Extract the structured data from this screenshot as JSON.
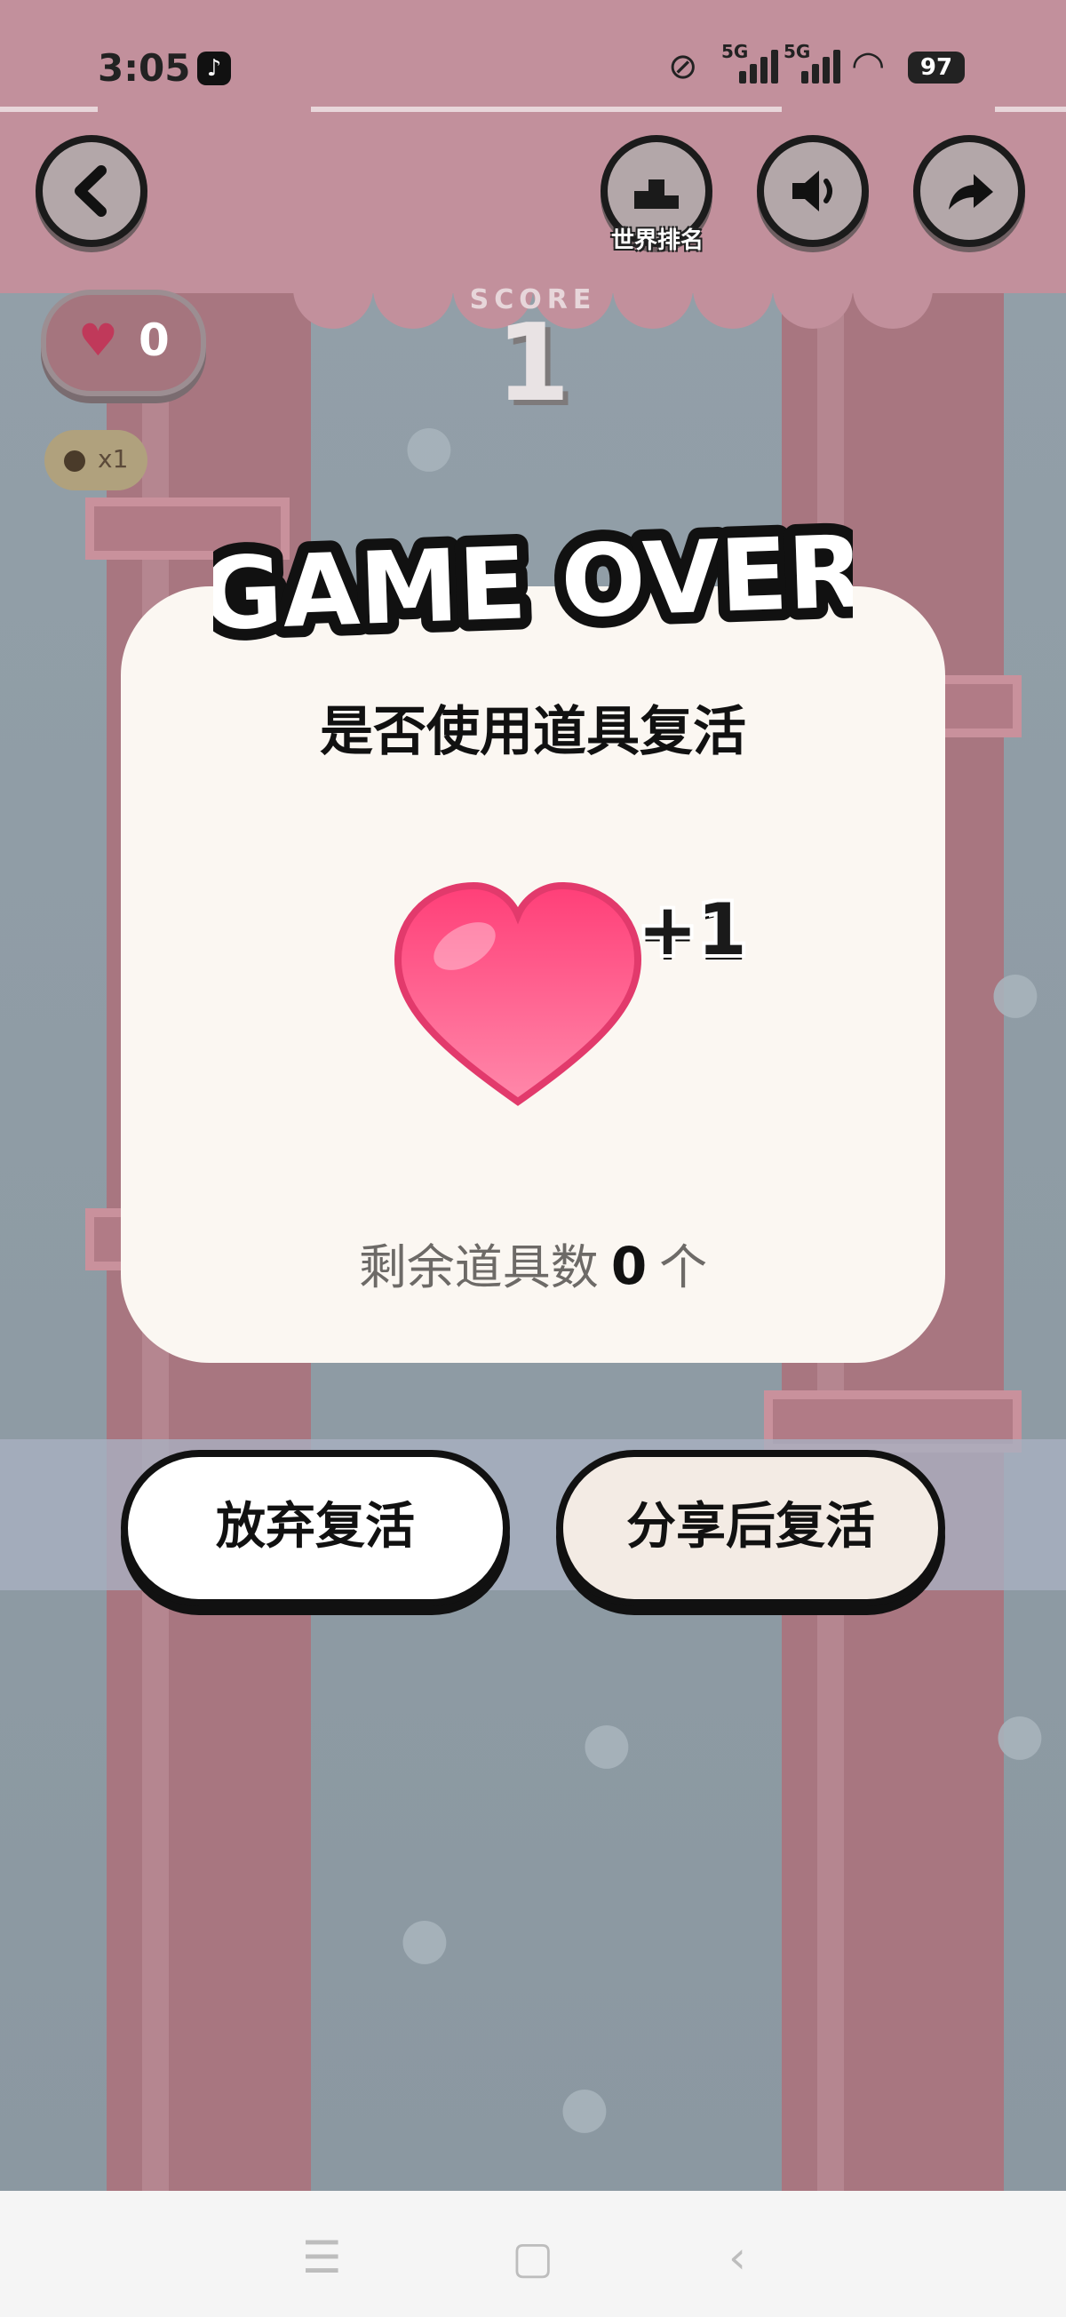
{
  "status_bar": {
    "time": "3:05",
    "app_icon": "tiktok-icon",
    "signal_1": "5G",
    "signal_2": "5G",
    "battery": "97"
  },
  "hud": {
    "back_icon": "chevron-left-icon",
    "ranking_label": "世界排名",
    "ranking_icon": "podium-icon",
    "sound_icon": "speaker-icon",
    "share_icon": "share-arrow-icon",
    "lives_count": "0",
    "coin_multiplier": "x1",
    "score_label": "SCORE",
    "score_value": "1"
  },
  "dialog": {
    "heading": "GAME OVER",
    "question": "是否使用道具复活",
    "reward_text": "+1",
    "remaining_prefix": "剩余道具数",
    "remaining_count": "0",
    "remaining_unit": "个",
    "give_up_label": "放弃复活",
    "share_revive_label": "分享后复活"
  },
  "colors": {
    "panel": "#fbf7f2",
    "heart": "#ff4f86",
    "pipe": "#a87680",
    "background": "#8e9aa2"
  }
}
